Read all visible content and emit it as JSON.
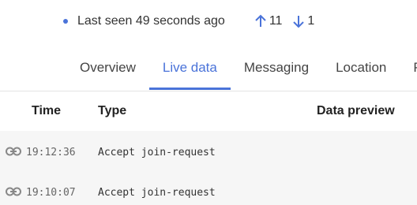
{
  "status": {
    "last_seen": "Last seen 49 seconds ago",
    "uplink_count": "11",
    "downlink_count": "1",
    "accent_color": "#4a73d9"
  },
  "tabs": [
    {
      "label": "Overview",
      "active": false
    },
    {
      "label": "Live data",
      "active": true
    },
    {
      "label": "Messaging",
      "active": false
    },
    {
      "label": "Location",
      "active": false
    },
    {
      "label": "Pa",
      "active": false
    }
  ],
  "table": {
    "headers": {
      "time": "Time",
      "type": "Type",
      "preview": "Data preview"
    },
    "rows": [
      {
        "icon": "link-icon",
        "time": "19:12:36",
        "type": "Accept join-request",
        "preview": ""
      },
      {
        "icon": "link-icon",
        "time": "19:10:07",
        "type": "Accept join-request",
        "preview": ""
      }
    ]
  }
}
